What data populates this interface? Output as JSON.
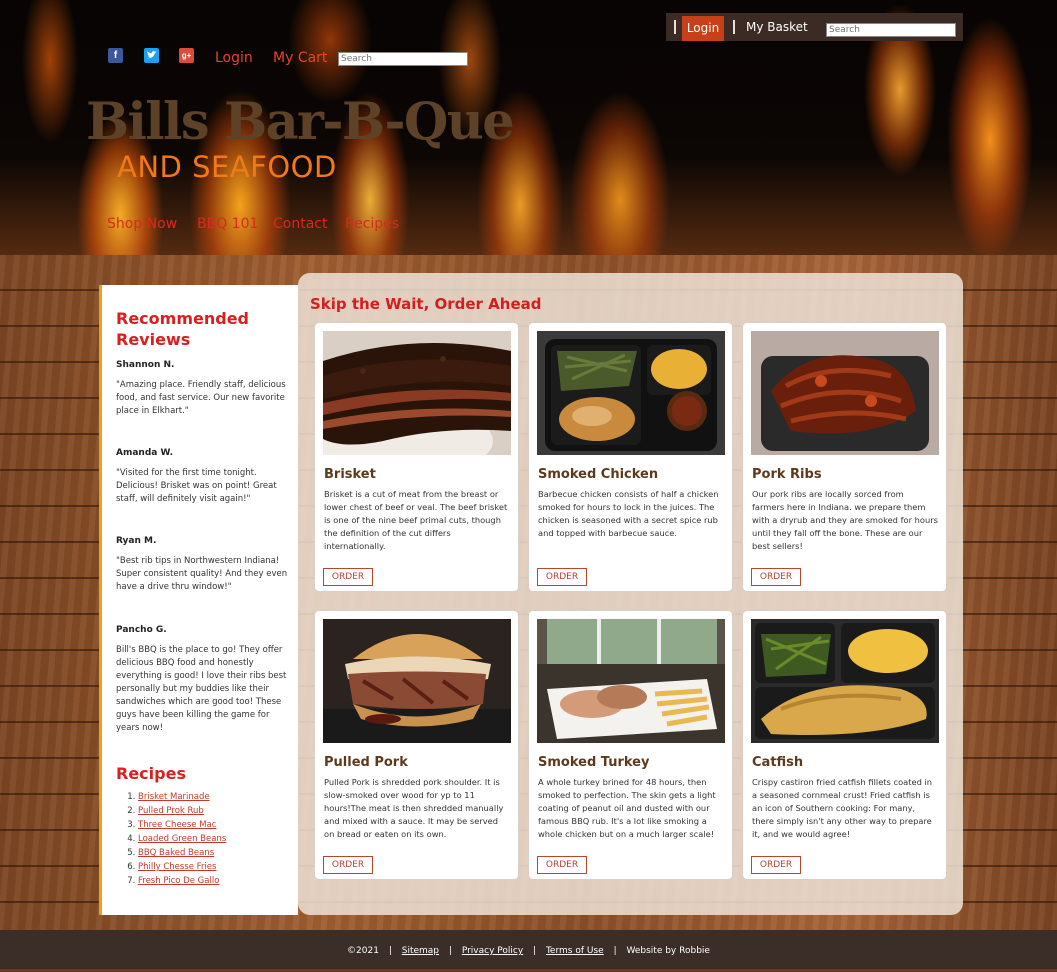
{
  "topbar": {
    "login_label": "Login",
    "basket_label": "My Basket",
    "search_placeholder": "Search"
  },
  "header": {
    "social": [
      "facebook-icon",
      "twitter-icon",
      "google-plus-icon"
    ],
    "login_label": "Login",
    "cart_label": "My Cart",
    "search_placeholder": "Search",
    "brand": "Bills Bar-B-Que",
    "tagline": "AND SEAFOOD",
    "nav": [
      "Shop Now",
      "BBQ 101",
      "Contact",
      "Recipes"
    ]
  },
  "sidebar": {
    "reviews_title_line1": "Recommended",
    "reviews_title_line2": "Reviews",
    "reviews": [
      {
        "name": "Shannon N.",
        "text": "\"Amazing place. Friendly staff, delicious food, and fast service. Our new favorite place in Elkhart.\""
      },
      {
        "name": "Amanda W.",
        "text": "\"Visited for the first time tonight. Delicious! Brisket was on point! Great staff, will definitely visit again!\""
      },
      {
        "name": "Ryan M.",
        "text": "\"Best rib tips in Northwestern Indiana! Super consistent quality! And they even have a drive thru window!\""
      },
      {
        "name": "Pancho G.",
        "text": "Bill's BBQ is the place to go! They offer delicious BBQ food and honestly everything is good! I love their ribs best personally but my buddies like their sandwiches which are good too! These guys have been killing the game for years now!"
      }
    ],
    "recipes_title": "Recipes",
    "recipes": [
      "Brisket Marinade",
      "Pulled Prok Rub",
      "Three Cheese Mac",
      "Loaded Green Beans",
      "BBQ Baked Beans",
      "Philly Chesse Fries",
      "Fresh Pico De Gallo"
    ]
  },
  "main": {
    "title": "Skip the Wait, Order Ahead",
    "order_label": "ORDER",
    "items": [
      {
        "name": "Brisket",
        "desc": "Brisket is a cut of meat from the breast or lower chest of beef or veal. The beef brisket is one of the nine beef primal cuts, though the definition of the cut differs internationally."
      },
      {
        "name": "Smoked Chicken",
        "desc": "Barbecue chicken consists of half a chicken smoked for hours to lock in the juices. The chicken is seasoned with a secret spice rub and topped with barbecue sauce."
      },
      {
        "name": "Pork Ribs",
        "desc": "Our pork ribs are locally sorced from farmers here in Indiana. we prepare them with a dryrub and they are smoked for hours until they fall off the bone. These are our best sellers!"
      },
      {
        "name": "Pulled Pork",
        "desc": "Pulled Pork is shredded pork shoulder. It is slow-smoked over wood for yp to 11 hours!The meat is then shredded manually and mixed with a sauce. It may be served on bread or eaten on its own."
      },
      {
        "name": "Smoked Turkey",
        "desc": "A whole turkey brined for 48 hours, then smoked to perfection. The skin gets a light coating of peanut oil and dusted with our famous BBQ rub. It's a lot like smoking a whole chicken but on a much larger scale!"
      },
      {
        "name": "Catfish",
        "desc": "Crispy castiron fried catfish fillets coated in a seasoned cornmeal crust! Fried catfish is an icon of Southern cooking: For many, there simply isn't any other way to prepare it, and we would agree!"
      }
    ]
  },
  "footer": {
    "copyright": "©2021",
    "links": [
      "Sitemap",
      "Privacy Policy",
      "Terms of Use"
    ],
    "credit": "Website by Robbie"
  },
  "colors": {
    "accent_red": "#d91f1f",
    "nav_red": "#d62b1e",
    "tagline_orange": "#f07a16",
    "footer_bg": "#3b2d27",
    "login_bg": "#c8401a"
  }
}
